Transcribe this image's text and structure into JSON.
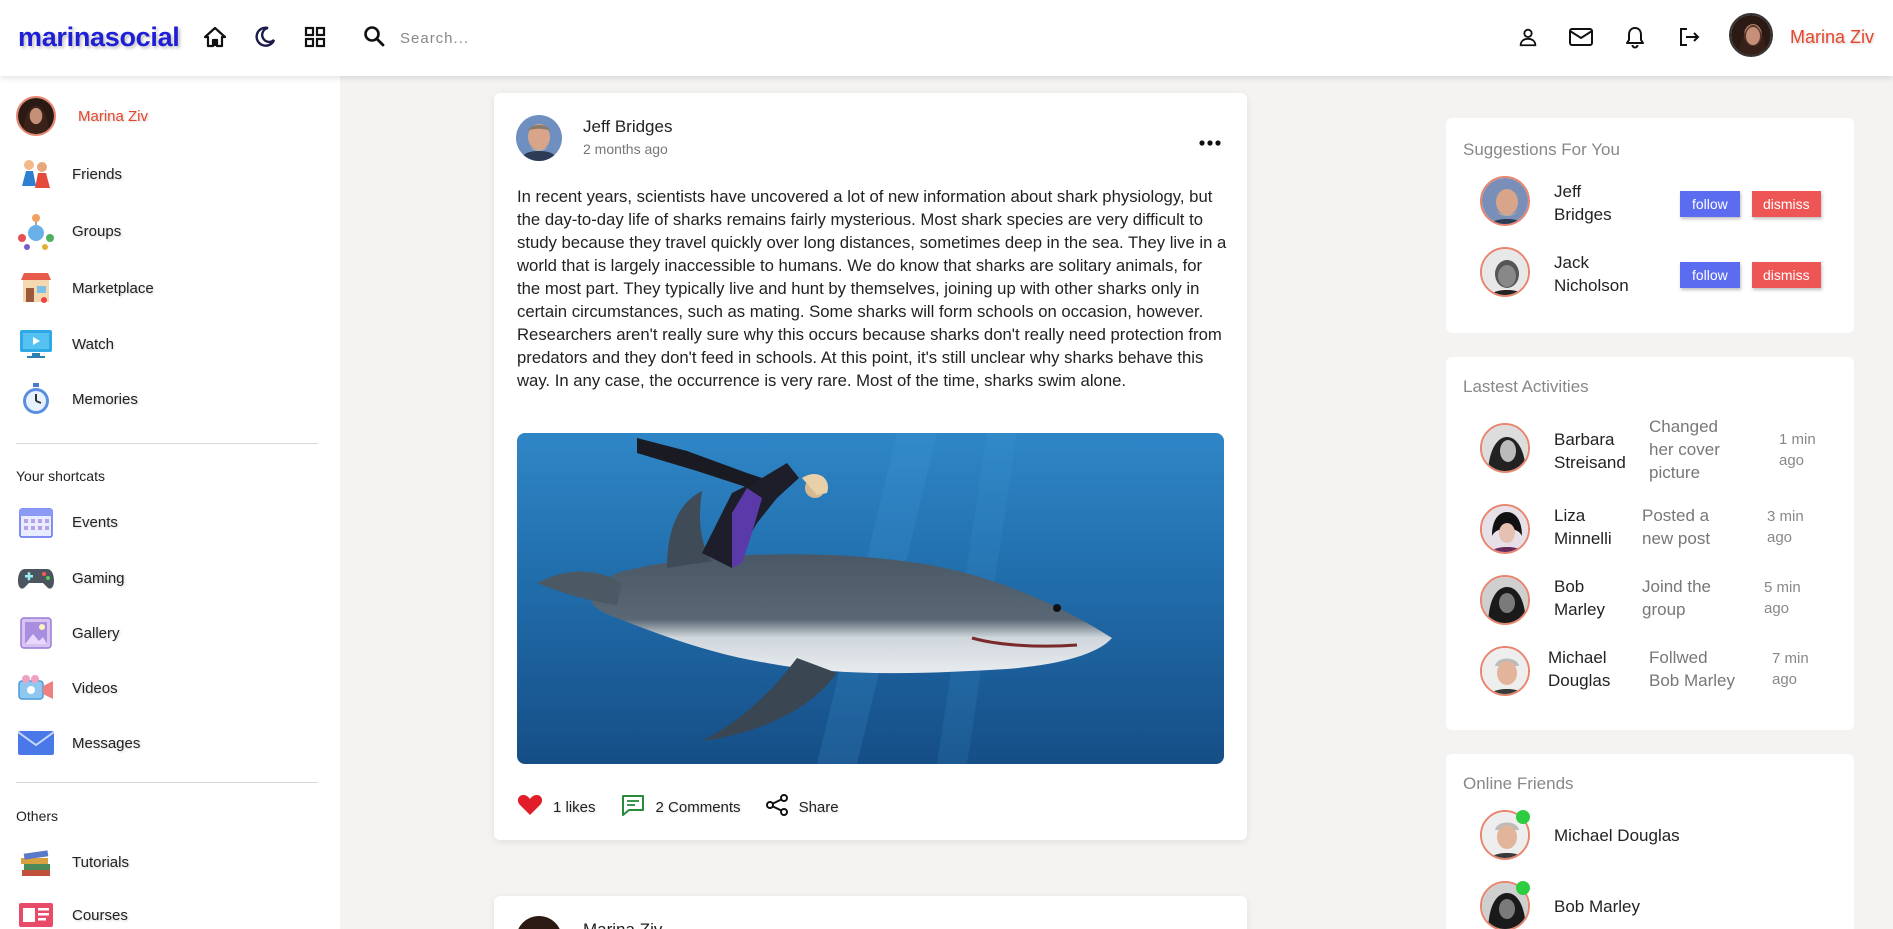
{
  "app": {
    "logo": "marinasocial"
  },
  "topbar": {
    "search_placeholder": "Search...",
    "user_name": "Marina Ziv"
  },
  "sidebar": {
    "profile_name": "Marina Ziv",
    "main_items": [
      {
        "label": "Friends",
        "icon": "friends-icon"
      },
      {
        "label": "Groups",
        "icon": "groups-icon"
      },
      {
        "label": "Marketplace",
        "icon": "marketplace-icon"
      },
      {
        "label": "Watch",
        "icon": "watch-icon"
      },
      {
        "label": "Memories",
        "icon": "memories-icon"
      }
    ],
    "shortcuts_heading": "Your shortcats",
    "shortcuts": [
      {
        "label": "Events",
        "icon": "events-icon"
      },
      {
        "label": "Gaming",
        "icon": "gaming-icon"
      },
      {
        "label": "Gallery",
        "icon": "gallery-icon"
      },
      {
        "label": "Videos",
        "icon": "videos-icon"
      },
      {
        "label": "Messages",
        "icon": "messages-icon"
      }
    ],
    "others_heading": "Others",
    "others": [
      {
        "label": "Tutorials",
        "icon": "tutorials-icon"
      },
      {
        "label": "Courses",
        "icon": "courses-icon"
      }
    ]
  },
  "feed": {
    "post1": {
      "author": "Jeff Bridges",
      "time": "2 months ago",
      "text": "In recent years, scientists have uncovered a lot of new information about shark physiology, but the day-to-day life of sharks remains fairly mysterious. Most shark species are very difficult to study because they travel quickly over long distances, sometimes deep in the sea. They live in a world that is largely inaccessible to humans. We do know that sharks are solitary animals, for the most part. They typically live and hunt by themselves, joining up with other sharks only in certain circumstances, such as mating. Some sharks will form schools on occasion, however. Researchers aren't really sure why this occurs because sharks don't really need protection from predators and they don't feed in schools. At this point, it's still unclear why sharks behave this way. In any case, the occurrence is very rare. Most of the time, sharks swim alone.",
      "likes": "1 likes",
      "comments": "2 Comments",
      "share": "Share"
    },
    "post2": {
      "author": "Marina Ziv"
    }
  },
  "suggestions": {
    "title": "Suggestions For You",
    "follow_label": "follow",
    "dismiss_label": "dismiss",
    "people": [
      {
        "name_line1": "Jeff",
        "name_line2": "Bridges"
      },
      {
        "name_line1": "Jack",
        "name_line2": "Nicholson"
      }
    ]
  },
  "activities": {
    "title": "Lastest Activities",
    "items": [
      {
        "name_line1": "Barbara",
        "name_line2": "Streisand",
        "text_lines": [
          "Changed",
          "her cover",
          "picture"
        ],
        "time_lines": [
          "1 min",
          "ago"
        ]
      },
      {
        "name_line1": "Liza",
        "name_line2": "Minnelli",
        "text_lines": [
          "Posted a",
          "new post"
        ],
        "time_lines": [
          "3 min",
          "ago"
        ]
      },
      {
        "name_line1": "Bob",
        "name_line2": "Marley",
        "text_lines": [
          "Joind the",
          "group"
        ],
        "time_lines": [
          "5 min",
          "ago"
        ]
      },
      {
        "name_line1": "Michael",
        "name_line2": "Douglas",
        "text_lines": [
          "Follwed",
          "Bob Marley"
        ],
        "time_lines": [
          "7 min",
          "ago"
        ]
      }
    ]
  },
  "online": {
    "title": "Online Friends",
    "friends": [
      {
        "name": "Michael Douglas"
      },
      {
        "name": "Bob Marley"
      }
    ]
  },
  "colors": {
    "logo": "#1f1fd6",
    "user_name": "#e8452c",
    "follow": "#5b6cf0",
    "dismiss": "#ee5555",
    "online": "#2ecc40",
    "like": "#e11d2a"
  }
}
